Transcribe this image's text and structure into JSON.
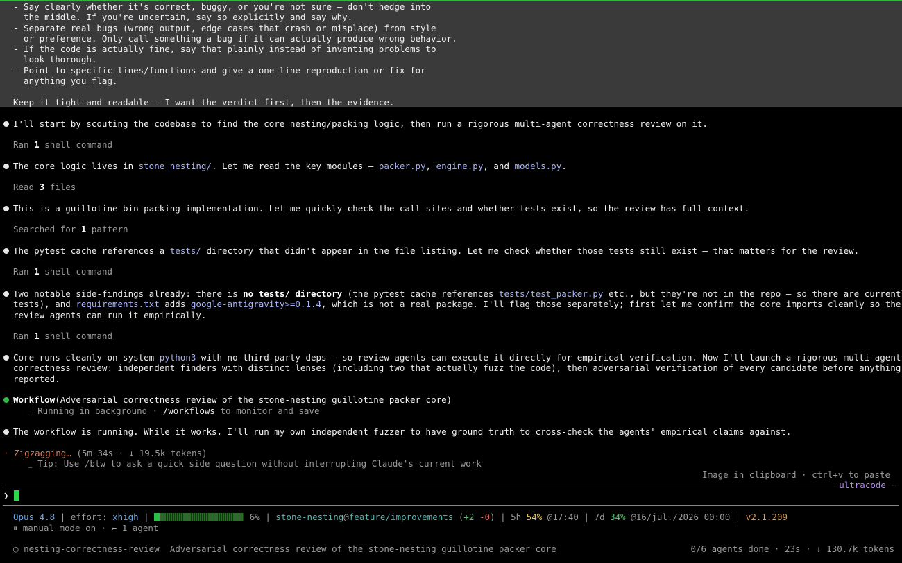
{
  "prompt": {
    "lines": [
      "- Say clearly whether it's correct, buggy, or you're not sure — don't hedge into",
      "  the middle. If you're uncertain, say so explicitly and say why.",
      "- Separate real bugs (wrong output, edge cases that crash or misplace) from style",
      "  or preference. Only call something a bug if it can actually produce wrong behavior.",
      "- If the code is actually fine, say that plainly instead of inventing problems to",
      "  look thorough.",
      "- Point to specific lines/functions and give a one-line reproduction or fix for",
      "  anything you flag.",
      "",
      "Keep it tight and readable — I want the verdict first, then the evidence."
    ]
  },
  "messages": {
    "m1": "I'll start by scouting the codebase to find the core nesting/packing logic, then run a rigorous multi-agent correctness review on it.",
    "t1_pre": "Ran ",
    "t1_num": "1",
    "t1_post": " shell command",
    "m2_a": "The core logic lives in ",
    "m2_dir": "stone_nesting/",
    "m2_b": ". Let me read the key modules — ",
    "m2_f1": "packer.py",
    "m2_c": ", ",
    "m2_f2": "engine.py",
    "m2_d": ", and ",
    "m2_f3": "models.py",
    "m2_e": ".",
    "t2_pre": "Read ",
    "t2_num": "3",
    "t2_post": " files",
    "m3": "This is a guillotine bin-packing implementation. Let me quickly check the call sites and whether tests exist, so the review has full context.",
    "t3_pre": "Searched for ",
    "t3_num": "1",
    "t3_post": " pattern",
    "m4_a": "The pytest cache references a ",
    "m4_dir": "tests/",
    "m4_b": " directory that didn't appear in the file listing. Let me check whether those tests still exist — that matters for the review.",
    "t4_pre": "Ran ",
    "t4_num": "1",
    "t4_post": " shell command",
    "m5_a": "Two notable side-findings already: there is ",
    "m5_b1": "no ",
    "m5_b2": "tests/",
    "m5_b3": " directory",
    "m5_c": " (the pytest cache references ",
    "m5_p1": "tests/test_packer.py",
    "m5_d": " etc., but they're not in the repo — so there are currently no",
    "m5_l2a": "tests), and ",
    "m5_p2": "requirements.txt",
    "m5_l2b": " adds ",
    "m5_p3": "google-antigravity>=0.1.4",
    "m5_l2c": ", which is not a real package. I'll flag those separately; first let me confirm the core imports cleanly so the",
    "m5_l3": "review agents can run it empirically.",
    "t5_pre": "Ran ",
    "t5_num": "1",
    "t5_post": " shell command",
    "m6_a": "Core runs cleanly on system ",
    "m6_p": "python3",
    "m6_b": " with no third-party deps — so review agents can execute it directly for empirical verification. Now I'll launch a rigorous multi-agent",
    "m6_l2": "correctness review: independent finders with distinct lenses (including two that actually fuzz the code), then adversarial verification of every candidate before anything is",
    "m6_l3": "reported.",
    "wf_name": "Workflow",
    "wf_arg": "(Adversarial correctness review of the stone-nesting guillotine packer core)",
    "wf_sub_a": "  ⎿ Running in background · ",
    "wf_sub_cmd": "/workflows",
    "wf_sub_b": " to monitor and save",
    "m7": "The workflow is running. While it works, I'll run my own independent fuzzer to have ground truth to cross-check the agents' empirical claims against."
  },
  "status": {
    "spinner": "·",
    "activity": "Zigzagging…",
    "activity_meta": " (5m 34s · ↓ 19.5k tokens)",
    "tip": "  ⎿ Tip: Use /btw to ask a quick side question without interrupting Claude's current work",
    "clipboard": "Image in clipboard · ctrl+v to paste",
    "mode_tag": "ultracode",
    "prompt_char": "❯"
  },
  "footer": {
    "model": "Opus 4.8",
    "sep1": " | effort: ",
    "effort": "xhigh",
    "sep2": " | ",
    "ctx_pct_value": 6,
    "ctx_pct": "6%",
    "sep3": " | ",
    "repo": "stone-nesting",
    "at": "@",
    "branch": "feature/improvements",
    "diff_open": " (",
    "diff_add": "+2",
    "diff_sep": " ",
    "diff_del": "-0",
    "diff_close": ")",
    "sep4": " | 5h ",
    "h5_pct": "54%",
    "h5_time": " @17:40 | 7d ",
    "d7_pct": "34%",
    "d7_time": " @16/jul./2026 00:00 | ",
    "version": "v2.1.209",
    "mode_line": "⏸ manual mode on · ← 1 agent",
    "agent_icon": "○",
    "agent_name": "nesting-correctness-review",
    "agent_desc": "Adversarial correctness review of the stone-nesting guillotine packer core",
    "agent_stats": "0/6 agents done · 23s · ↓ 130.7k tokens"
  },
  "colors": {
    "accent_green": "#2fbd4a",
    "path_purple": "#a9b4f5",
    "activity_orange": "#e07b53"
  }
}
